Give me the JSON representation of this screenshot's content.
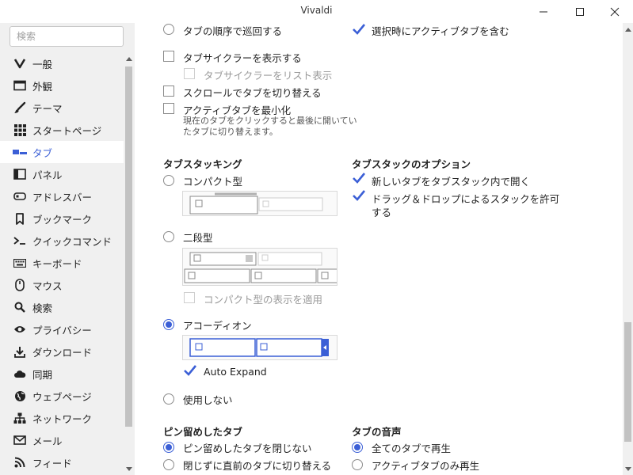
{
  "window": {
    "title": "Vivaldi"
  },
  "sidebar": {
    "search_placeholder": "検索",
    "items": [
      {
        "label": "一般",
        "icon": "vivaldi-logo-icon"
      },
      {
        "label": "外観",
        "icon": "window-icon"
      },
      {
        "label": "テーマ",
        "icon": "brush-icon"
      },
      {
        "label": "スタートページ",
        "icon": "grid-icon"
      },
      {
        "label": "タブ",
        "icon": "tabs-icon",
        "active": true
      },
      {
        "label": "パネル",
        "icon": "panel-icon"
      },
      {
        "label": "アドレスバー",
        "icon": "address-bar-icon"
      },
      {
        "label": "ブックマーク",
        "icon": "bookmark-icon"
      },
      {
        "label": "クイックコマンド",
        "icon": "quick-command-icon"
      },
      {
        "label": "キーボード",
        "icon": "keyboard-icon"
      },
      {
        "label": "マウス",
        "icon": "mouse-icon"
      },
      {
        "label": "検索",
        "icon": "search-icon"
      },
      {
        "label": "プライバシー",
        "icon": "eye-icon"
      },
      {
        "label": "ダウンロード",
        "icon": "download-icon"
      },
      {
        "label": "同期",
        "icon": "cloud-icon"
      },
      {
        "label": "ウェブページ",
        "icon": "globe-icon"
      },
      {
        "label": "ネットワーク",
        "icon": "network-icon"
      },
      {
        "label": "メール",
        "icon": "mail-icon"
      },
      {
        "label": "フィード",
        "icon": "feed-icon"
      }
    ]
  },
  "tab_options": {
    "cycle_order": "タブの順序で巡回する",
    "include_active": "選択時にアクティブタブを含む",
    "show_cycler": "タブサイクラーを表示する",
    "cycler_list": "タブサイクラーをリスト表示",
    "scroll_switch": "スクロールでタブを切り替える",
    "minimize_active": "アクティブタブを最小化",
    "minimize_desc_1": "現在のタブをクリックすると最後に開いてい",
    "minimize_desc_2": "たタブに切り替えます。"
  },
  "stacking": {
    "heading": "タブスタッキング",
    "compact": "コンパクト型",
    "two_level": "二段型",
    "apply_compact": "コンパクト型の表示を適用",
    "accordion": "アコーディオン",
    "auto_expand": "Auto Expand",
    "none": "使用しない"
  },
  "stack_options": {
    "heading": "タブスタックのオプション",
    "open_in_stack": "新しいタブをタブスタック内で開く",
    "drag_drop_1": "ドラッグ＆ドロップによるスタックを許可",
    "drag_drop_2": "する"
  },
  "pinned": {
    "heading": "ピン留めしたタブ",
    "dont_close": "ピン留めしたタブを閉じない",
    "switch_prev": "閉じずに直前のタブに切り替える"
  },
  "audio": {
    "heading": "タブの音声",
    "play_all": "全てのタブで再生",
    "active_only": "アクティブタブのみ再生"
  },
  "colors": {
    "accent": "#3b5fd6",
    "sidebar_bg": "#f0f0f0"
  }
}
